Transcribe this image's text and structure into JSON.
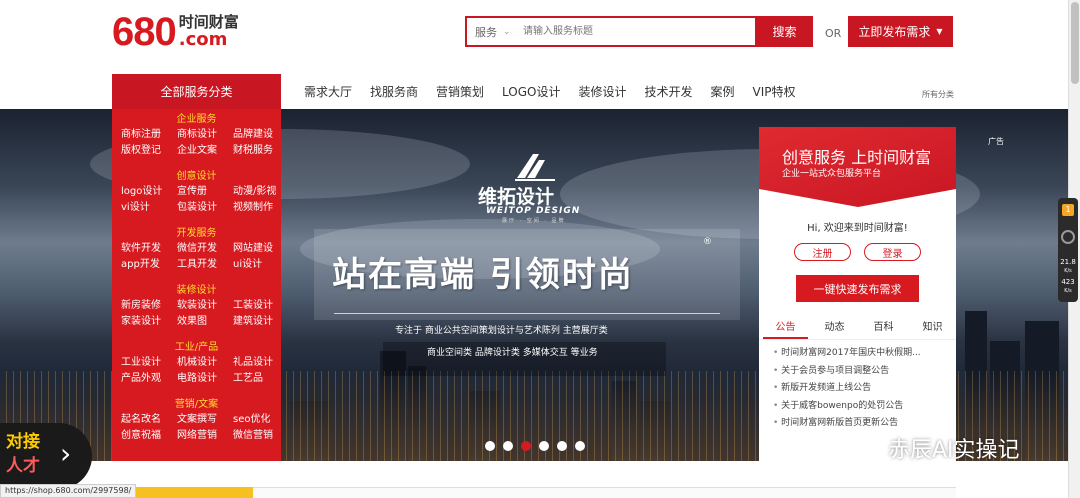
{
  "header": {
    "logo_number": "680",
    "logo_cn": "时间财富",
    "logo_com": ".com",
    "search": {
      "type_label": "服务",
      "placeholder": "请输入服务标题",
      "button_label": "搜索"
    },
    "or_label": "OR",
    "publish_label": "立即发布需求"
  },
  "nav": {
    "all_categories": "全部服务分类",
    "items": [
      "需求大厅",
      "找服务商",
      "营销策划",
      "LOGO设计",
      "装修设计",
      "技术开发",
      "案例",
      "VIP特权"
    ],
    "more": "所有分类"
  },
  "categories": [
    {
      "title": "企业服务",
      "rows": [
        [
          "商标注册",
          "商标设计",
          "品牌建设"
        ],
        [
          "版权登记",
          "企业文案",
          "财税服务"
        ]
      ]
    },
    {
      "title": "创意设计",
      "rows": [
        [
          "logo设计",
          "宣传册",
          "动漫/影视"
        ],
        [
          "vi设计",
          "包装设计",
          "视频制作"
        ]
      ]
    },
    {
      "title": "开发服务",
      "rows": [
        [
          "软件开发",
          "微信开发",
          "网站建设"
        ],
        [
          "app开发",
          "工具开发",
          "ui设计"
        ]
      ]
    },
    {
      "title": "装修设计",
      "rows": [
        [
          "新房装修",
          "软装设计",
          "工装设计"
        ],
        [
          "家装设计",
          "效果图",
          "建筑设计"
        ]
      ]
    },
    {
      "title": "工业/产品",
      "rows": [
        [
          "工业设计",
          "机械设计",
          "礼品设计"
        ],
        [
          "产品外观",
          "电路设计",
          "工艺品"
        ]
      ]
    },
    {
      "title": "营销/文案",
      "rows": [
        [
          "起名改名",
          "文案撰写",
          "seo优化"
        ],
        [
          "创意祝福",
          "网络营销",
          "微信营销"
        ]
      ]
    }
  ],
  "banner": {
    "brand_name": "维拓设计",
    "brand_sub": "WEITOP DESIGN",
    "brand_tiny": "展厅 · 空间 · 品牌",
    "slogan": "站在高端  引领时尚",
    "reg_mark": "®",
    "line1": "专注于 商业公共空间策划设计与艺术陈列 主营展厅类",
    "line2": "商业空间类 品牌设计类 多媒体交互 等业务",
    "ad_label": "广告",
    "dot_count": 6,
    "active_dot": 2
  },
  "side": {
    "title": "创意服务 上时间财富",
    "subtitle": "企业一站式众包服务平台",
    "greeting": "Hi, 欢迎来到时间财富!",
    "register": "注册",
    "login": "登录",
    "quick_publish": "一键快速发布需求",
    "tabs": [
      "公告",
      "动态",
      "百科",
      "知识"
    ],
    "news": [
      "时间财富网2017年国庆中秋假期...",
      "关于会员参与项目调整公告",
      "新版开发频道上线公告",
      "关于威客bowenpo的处罚公告",
      "时间财富网新版首页更新公告"
    ]
  },
  "float_tab": {
    "line1": "对接",
    "line2": "人才",
    "arrow": "›"
  },
  "status_url": "https://shop.680.com/2997598/",
  "watermark": "赤辰AI实操记",
  "widget": {
    "badge": "1",
    "speed_up": "21.8",
    "speed_up_unit": "K/s",
    "speed_down": "423",
    "speed_down_unit": "K/s"
  },
  "colors": {
    "brand_red": "#d71920",
    "button_red": "#c81623",
    "category_title": "#ffdf2e"
  }
}
